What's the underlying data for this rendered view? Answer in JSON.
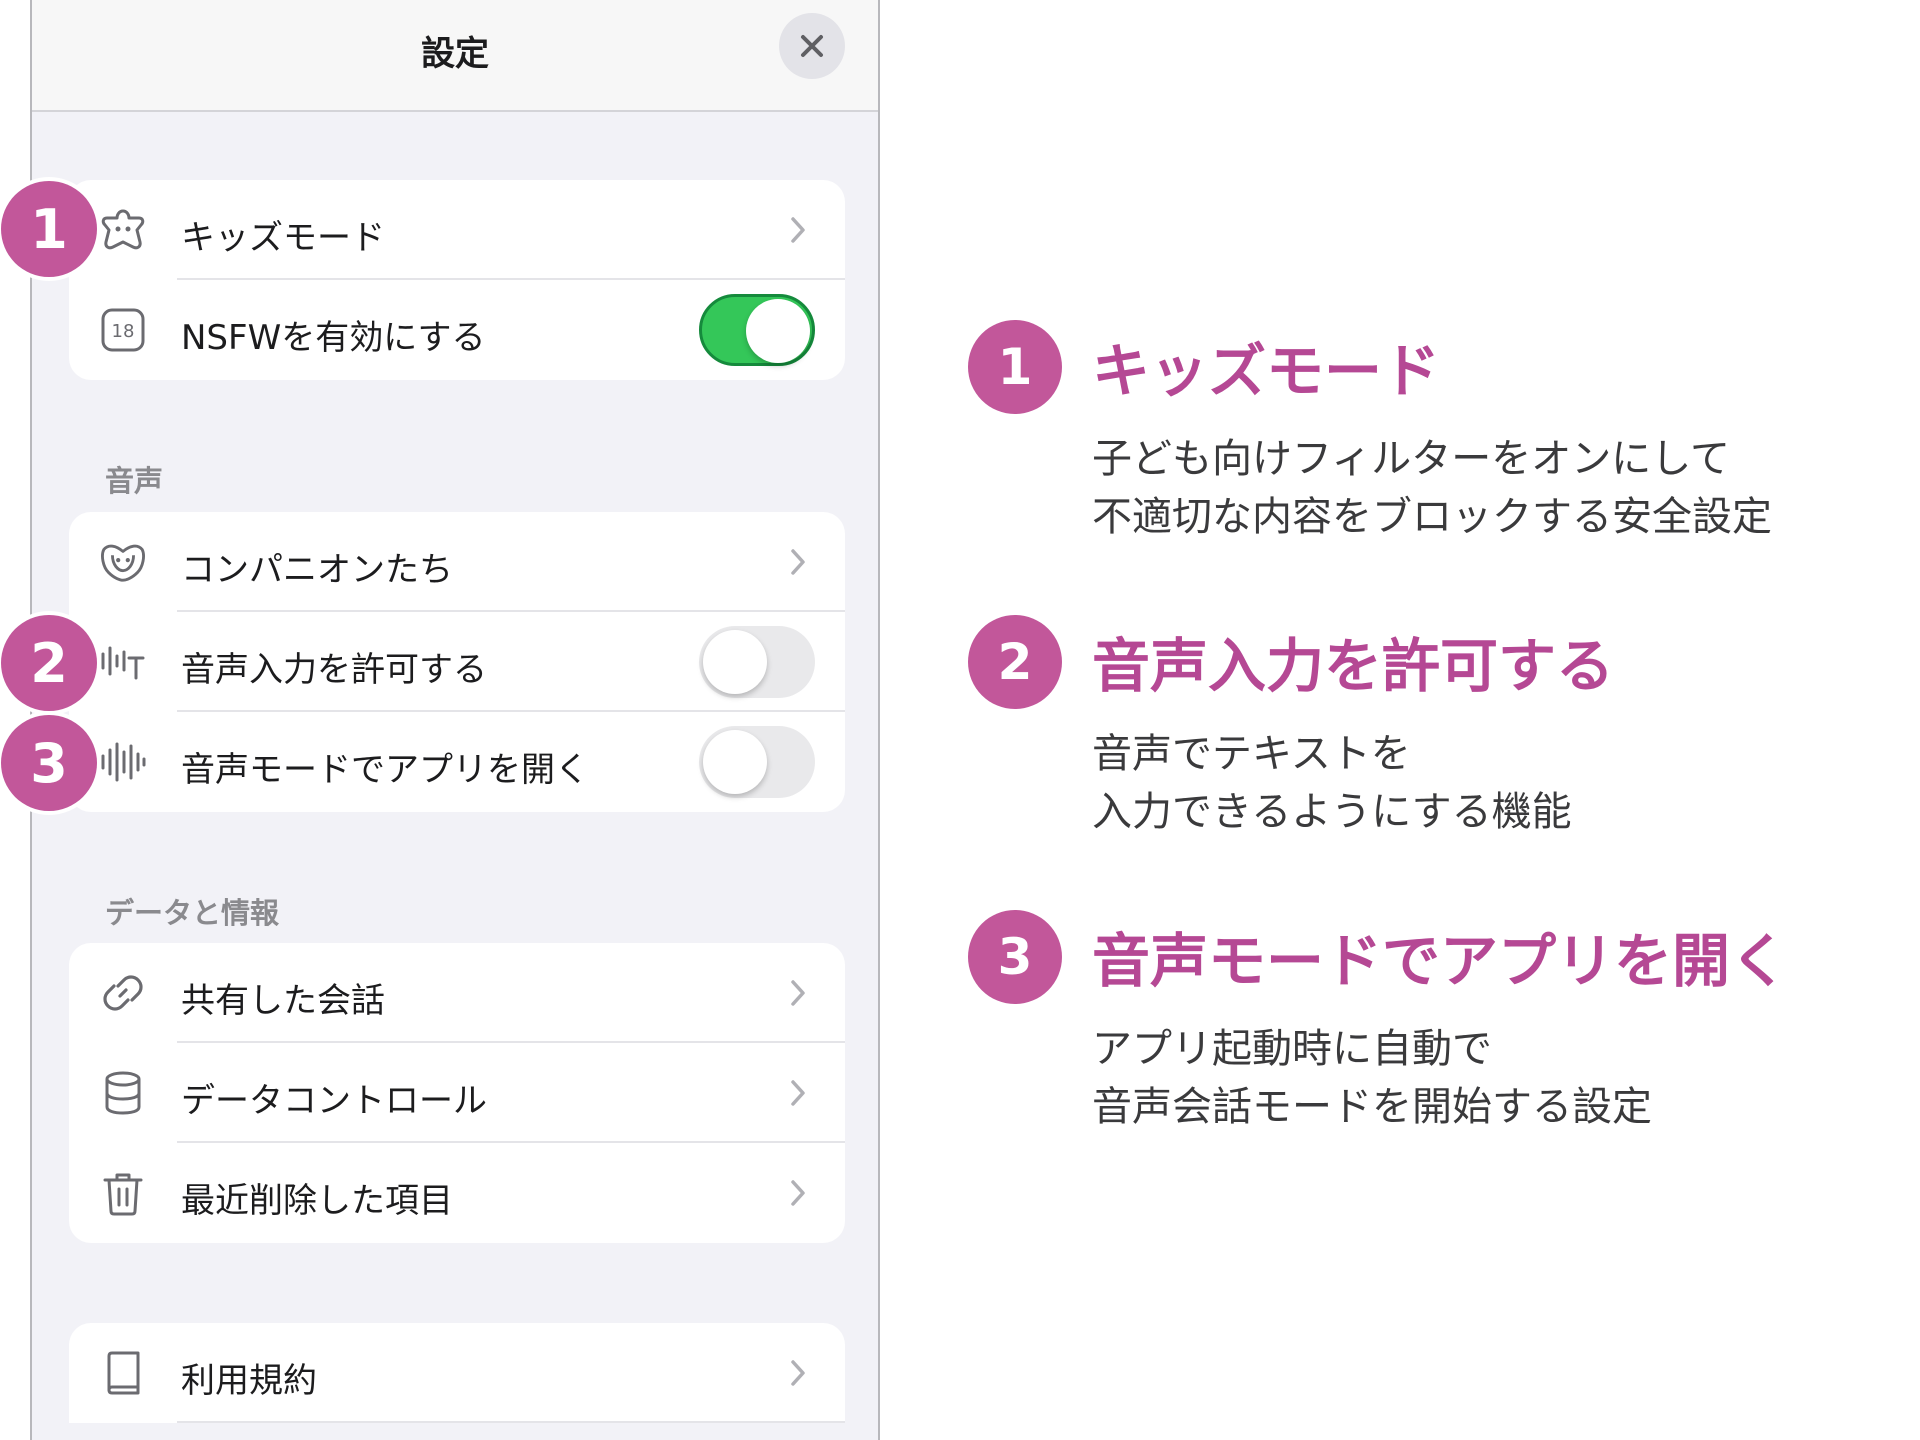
{
  "header": {
    "title": "設定"
  },
  "groups": {
    "top": {
      "rows": [
        {
          "label": "キッズモード"
        },
        {
          "label": "NSFWを有効にする",
          "toggle_on": true
        }
      ]
    },
    "voice": {
      "section_label": "音声",
      "rows": [
        {
          "label": "コンパニオンたち"
        },
        {
          "label": "音声入力を許可する",
          "toggle_on": false
        },
        {
          "label": "音声モードでアプリを開く",
          "toggle_on": false
        }
      ]
    },
    "data": {
      "section_label": "データと情報",
      "rows": [
        {
          "label": "共有した会話"
        },
        {
          "label": "データコントロール"
        },
        {
          "label": "最近削除した項目"
        }
      ]
    },
    "legal": {
      "rows": [
        {
          "label": "利用規約"
        }
      ]
    }
  },
  "icon_text": {
    "age_rating": "18"
  },
  "badges": [
    "1",
    "2",
    "3"
  ],
  "annotations": [
    {
      "number": "1",
      "title": "キッズモード",
      "desc_line1": "子ども向けフィルターをオンにして",
      "desc_line2": "不適切な内容をブロックする安全設定"
    },
    {
      "number": "2",
      "title": "音声入力を許可する",
      "desc_line1": "音声でテキストを",
      "desc_line2": "入力できるようにする機能"
    },
    {
      "number": "3",
      "title": "音声モードでアプリを開く",
      "desc_line1": "アプリ起動時に自動で",
      "desc_line2": "音声会話モードを開始する設定"
    }
  ],
  "colors": {
    "accent": "#c2579a",
    "accent_title": "#b54894",
    "toggle_on": "#34c759",
    "toggle_off": "#e9e9eb",
    "panel_bg": "#f2f2f7"
  },
  "icons": [
    "close-icon",
    "kids-mode-icon",
    "age-18-icon",
    "companions-icon",
    "voice-input-icon",
    "waveform-icon",
    "link-icon",
    "database-icon",
    "trash-icon",
    "book-icon",
    "chevron-right-icon"
  ]
}
